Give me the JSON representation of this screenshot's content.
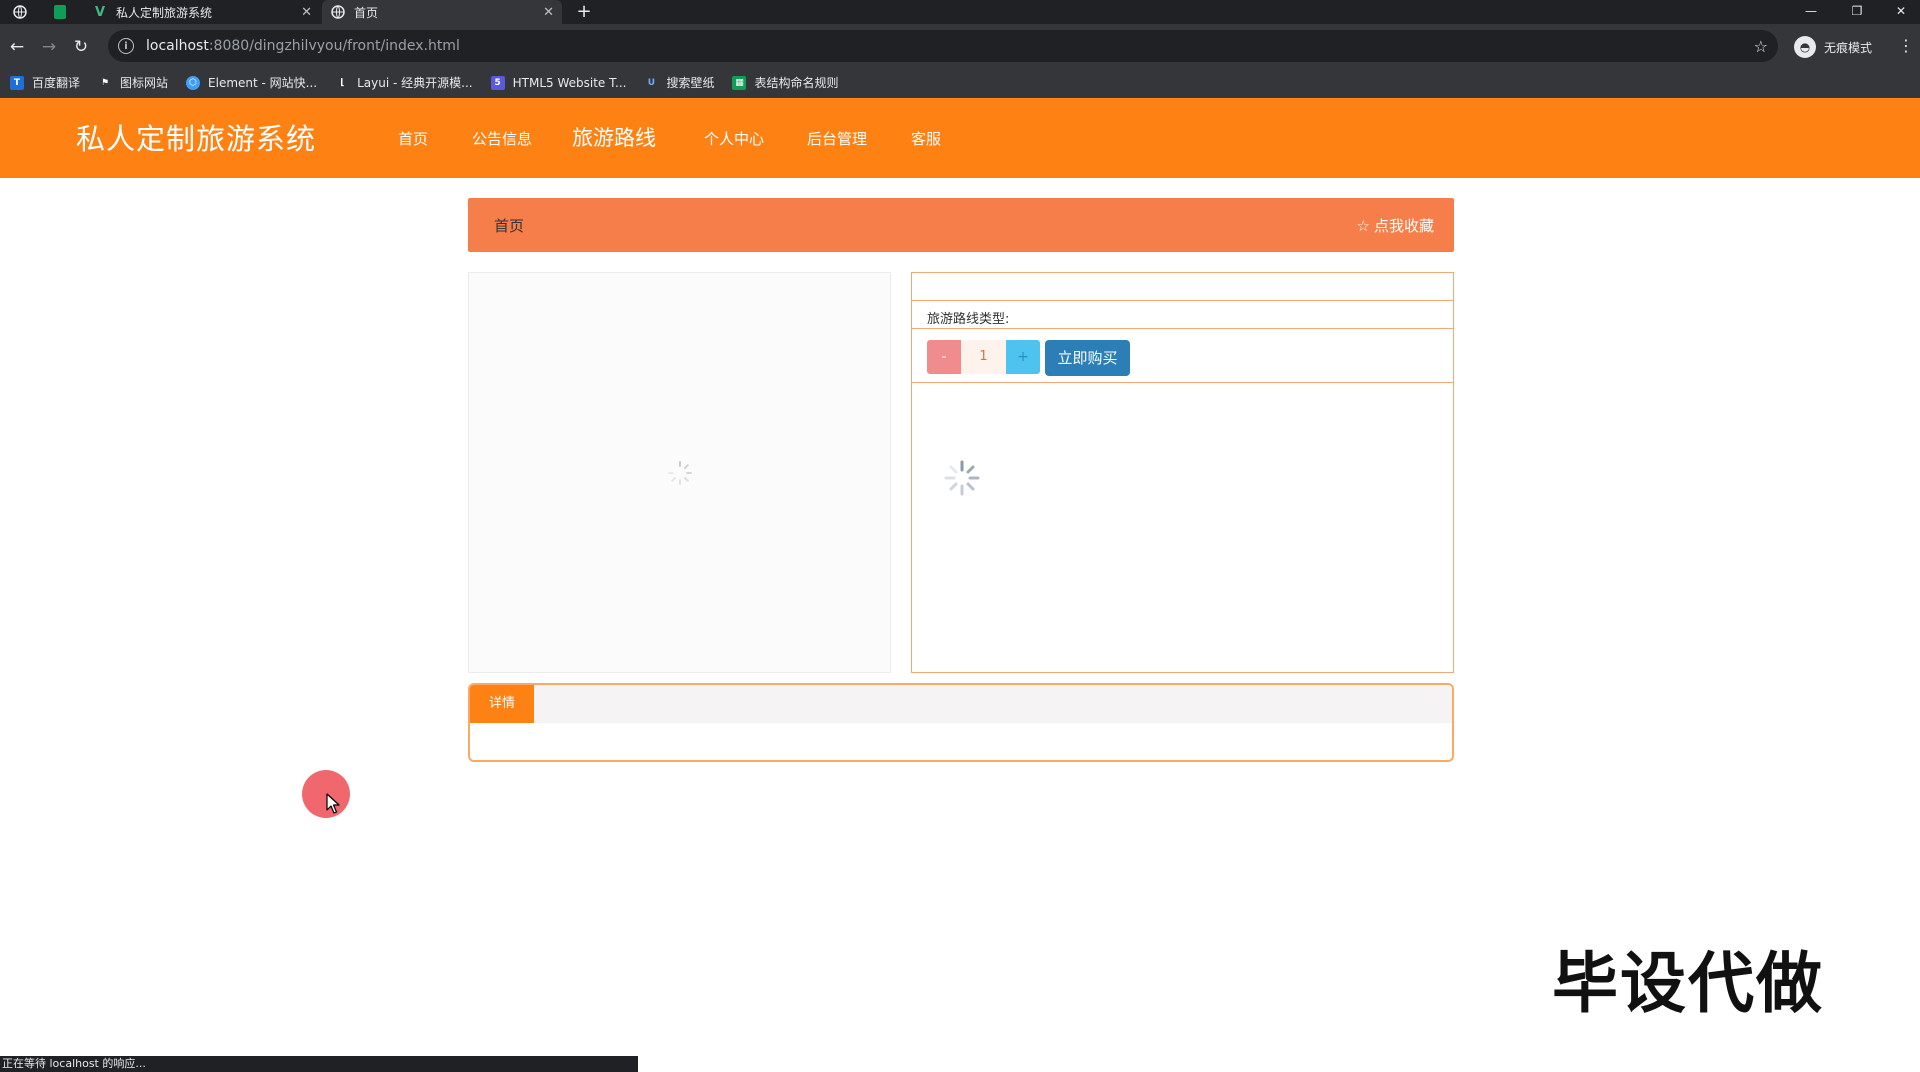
{
  "browser": {
    "tabs": [
      {
        "title": "私人定制旅游系统",
        "favicon": "vue-icon"
      },
      {
        "title": "首页",
        "favicon": "globe-icon"
      }
    ],
    "url_host": "localhost",
    "url_path": ":8080/dingzhilvyou/front/index.html",
    "profile_label": "无痕模式",
    "bookmarks": [
      {
        "label": "百度翻译",
        "icon": "baidu-translate-icon",
        "color": "#1e6fd9"
      },
      {
        "label": "图标网站",
        "icon": "flag-icon",
        "color": "#35363a"
      },
      {
        "label": "Element - 网站快...",
        "icon": "element-icon",
        "color": "#409eff"
      },
      {
        "label": "Layui - 经典开源模...",
        "icon": "layui-icon",
        "color": "#35363a"
      },
      {
        "label": "HTML5 Website T...",
        "icon": "html5-icon",
        "color": "#5a5adb"
      },
      {
        "label": "搜索壁纸",
        "icon": "wallpaper-icon",
        "color": "#3b7de0"
      },
      {
        "label": "表结构命名规则",
        "icon": "sheet-icon",
        "color": "#0f9d58"
      }
    ],
    "status_text": "正在等待 localhost 的响应..."
  },
  "site": {
    "title": "私人定制旅游系统",
    "nav": [
      "首页",
      "公告信息",
      "旅游路线",
      "个人中心",
      "后台管理",
      "客服"
    ],
    "active_nav": "旅游路线",
    "brand_color": "#fe8114"
  },
  "breadcrumb": {
    "current": "首页",
    "favorite_label": "点我收藏"
  },
  "product": {
    "type_label": "旅游路线类型:",
    "quantity": "1",
    "minus_label": "-",
    "plus_label": "+",
    "buy_label": "立即购买"
  },
  "detail": {
    "tab_label": "详情"
  },
  "watermark": "毕设代做"
}
